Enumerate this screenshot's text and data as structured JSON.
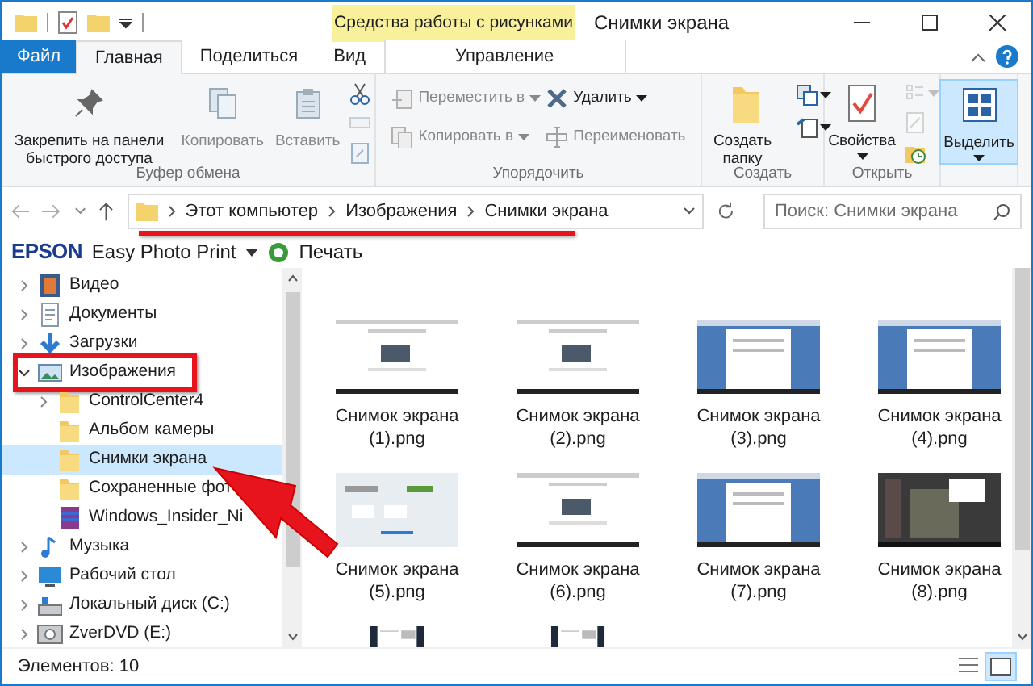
{
  "window": {
    "title": "Снимки экрана",
    "context_header": "Средства работы с рисунками"
  },
  "tabs": [
    {
      "label": "Файл",
      "kind": "file",
      "selected": false
    },
    {
      "label": "Главная",
      "kind": "normal",
      "selected": true
    },
    {
      "label": "Поделиться",
      "kind": "normal",
      "selected": false
    },
    {
      "label": "Вид",
      "kind": "normal",
      "selected": false
    },
    {
      "label": "Управление",
      "kind": "context",
      "selected": false
    }
  ],
  "ribbon": {
    "groups": [
      {
        "label": "Буфер обмена",
        "columns": [
          [
            {
              "kind": "large",
              "label": "Закрепить на панели быстрого доступа",
              "disabled": false
            }
          ],
          [
            {
              "kind": "large",
              "label": "Копировать",
              "disabled": true
            }
          ],
          [
            {
              "kind": "large",
              "label": "Вставить",
              "disabled": true
            }
          ],
          [
            {
              "kind": "icon",
              "disabled": false
            },
            {
              "kind": "icon",
              "disabled": true
            },
            {
              "kind": "icon",
              "disabled": true
            }
          ]
        ]
      },
      {
        "label": "Упорядочить",
        "columns": [
          [
            {
              "kind": "small",
              "label": "Переместить в",
              "dropdown": true,
              "disabled": true
            },
            {
              "kind": "small",
              "label": "Копировать в",
              "dropdown": true,
              "disabled": true
            }
          ],
          [
            {
              "kind": "small",
              "label": "Удалить",
              "dropdown": true,
              "disabled": false
            },
            {
              "kind": "small",
              "label": "Переименовать",
              "disabled": true
            }
          ]
        ]
      },
      {
        "label": "Создать",
        "columns": [
          [
            {
              "kind": "large",
              "label": "Создать папку",
              "disabled": false
            }
          ],
          [
            {
              "kind": "icon",
              "dropdown": true,
              "disabled": false
            },
            {
              "kind": "icon",
              "dropdown": true,
              "disabled": false
            }
          ]
        ]
      },
      {
        "label": "Открыть",
        "columns": [
          [
            {
              "kind": "large",
              "label": "Свойства",
              "dropdown": true,
              "disabled": false
            }
          ],
          [
            {
              "kind": "icon",
              "dropdown": true,
              "disabled": true
            },
            {
              "kind": "icon",
              "disabled": true
            },
            {
              "kind": "icon",
              "disabled": false
            }
          ]
        ]
      },
      {
        "columns": [
          [
            {
              "kind": "large",
              "label": "Выделить",
              "dropdown": true,
              "disabled": false,
              "pressed": true
            }
          ]
        ]
      }
    ]
  },
  "address": {
    "path": [
      "Этот компьютер",
      "Изображения",
      "Снимки экрана"
    ],
    "highlighted": true,
    "search_placeholder": "Поиск: Снимки экрана"
  },
  "epson_bar": {
    "logo": "EPSON",
    "app": "Easy Photo Print",
    "action": "Печать"
  },
  "tree": [
    {
      "label": "Видео",
      "kind": "video",
      "expanded": false,
      "selected": false
    },
    {
      "label": "Документы",
      "kind": "documents",
      "expanded": false,
      "selected": false
    },
    {
      "label": "Загрузки",
      "kind": "downloads",
      "expanded": false,
      "selected": false
    },
    {
      "label": "Изображения",
      "kind": "pictures",
      "expanded": true,
      "selected": false,
      "highlighted": true,
      "children": [
        {
          "label": "ControlCenter4",
          "kind": "folder",
          "expanded": false,
          "selected": false
        },
        {
          "label": "Альбом камеры",
          "kind": "folder",
          "selected": false
        },
        {
          "label": "Снимки экрана",
          "kind": "folder",
          "selected": true
        },
        {
          "label": "Сохраненные фот",
          "kind": "folder",
          "selected": false
        },
        {
          "label": "Windows_Insider_Ni",
          "kind": "archive",
          "selected": false
        }
      ]
    },
    {
      "label": "Музыка",
      "kind": "music",
      "expanded": false,
      "selected": false
    },
    {
      "label": "Рабочий стол",
      "kind": "desktop",
      "expanded": false,
      "selected": false
    },
    {
      "label": "Локальный диск (C:)",
      "kind": "drive",
      "expanded": false,
      "selected": false
    },
    {
      "label": "ZverDVD (E:)",
      "kind": "dvd",
      "expanded": false,
      "selected": false
    }
  ],
  "files": [
    {
      "name": "Снимок экрана (1).png",
      "kind": "picture"
    },
    {
      "name": "Снимок экрана (2).png",
      "kind": "picture"
    },
    {
      "name": "Снимок экрана (3).png",
      "kind": "picture"
    },
    {
      "name": "Снимок экрана (4).png",
      "kind": "picture"
    },
    {
      "name": "Снимок экрана (5).png",
      "kind": "picture"
    },
    {
      "name": "Снимок экрана (6).png",
      "kind": "picture"
    },
    {
      "name": "Снимок экрана (7).png",
      "kind": "picture"
    },
    {
      "name": "Снимок экрана (8).png",
      "kind": "picture"
    },
    {
      "kind": "picture"
    },
    {
      "kind": "picture"
    }
  ],
  "status_bar": {
    "count": "Элементов: 10",
    "view_buttons": [
      {
        "kind": "details",
        "selected": false
      },
      {
        "kind": "large_icons",
        "selected": true
      }
    ]
  }
}
